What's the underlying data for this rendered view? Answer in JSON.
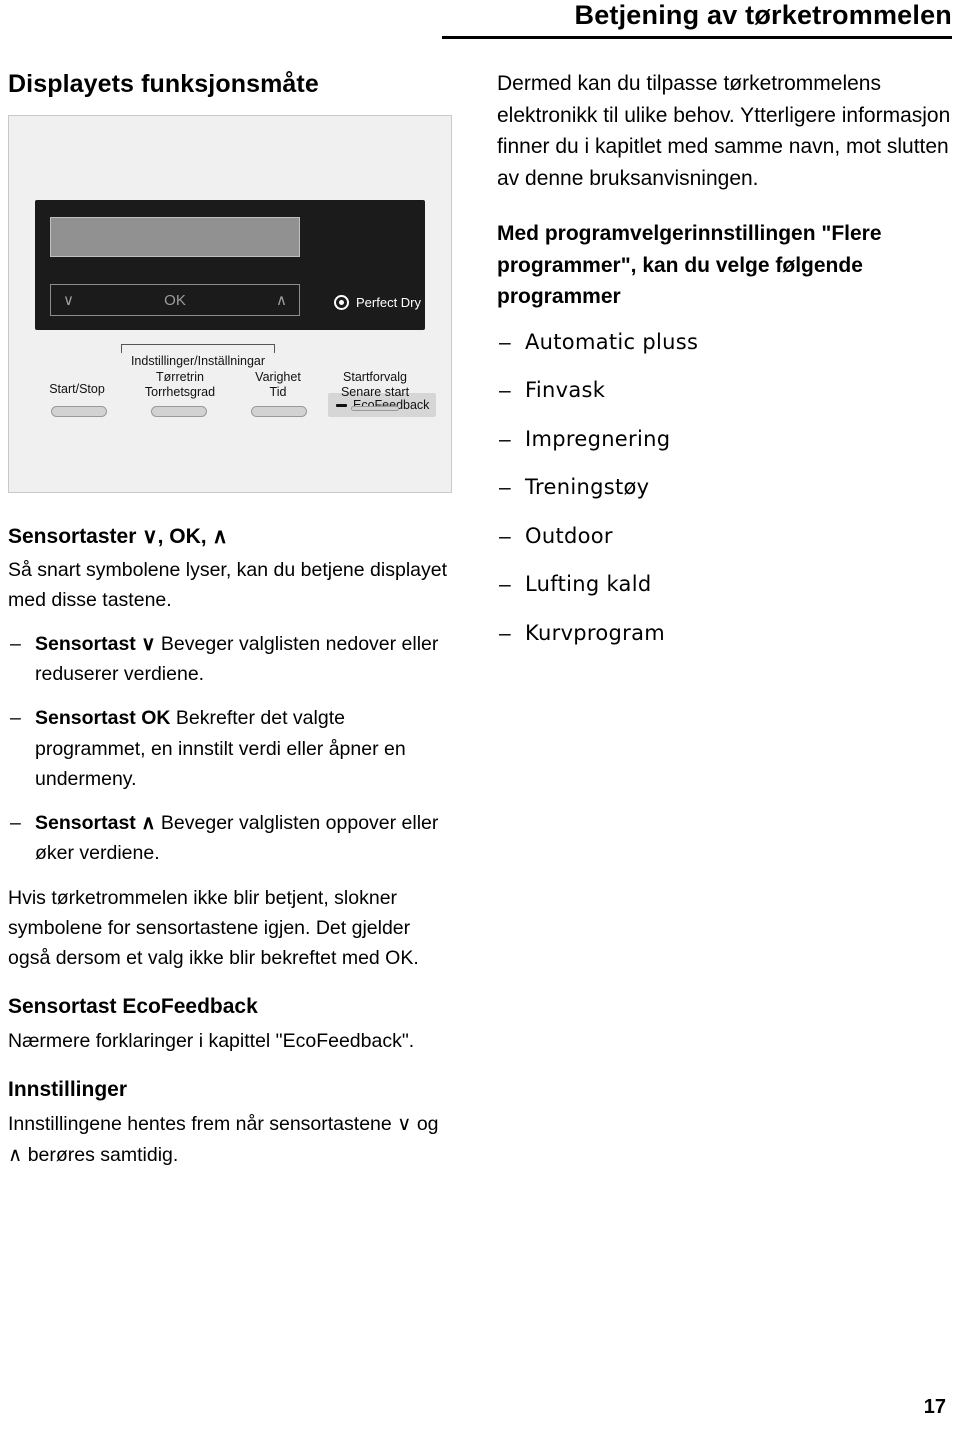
{
  "header": {
    "title": "Betjening av tørketrommelen"
  },
  "left": {
    "section_title": "Displayets funksjonsmåte",
    "panel": {
      "display_nav": {
        "down": "∨",
        "ok": "OK",
        "up": "∧"
      },
      "perfect_dry": "Perfect Dry",
      "ecofeedback": "EcoFeedback",
      "labels": {
        "start_stop": "Start/Stop",
        "settings": "Indstillinger/Inställningar",
        "dryness_1": "Tørretrin",
        "dryness_2": "Torrhetsgrad",
        "duration_1": "Varighet",
        "duration_2": "Tid",
        "delay_1": "Startforvalg",
        "delay_2": "Senare start"
      }
    },
    "sensor_heading": "Sensortaster ∨, OK, ∧",
    "sensor_intro": "Så snart symbolene lyser, kan du betjene displayet med disse tastene.",
    "bullets": [
      {
        "head": "Sensortast ∨",
        "body": "Beveger valglisten nedover eller reduserer verdiene."
      },
      {
        "head": "Sensortast OK",
        "body": "Bekrefter det valgte programmet, en innstilt verdi eller åpner en undermeny."
      },
      {
        "head": "Sensortast ∧",
        "body": "Beveger valglisten oppover eller øker verdiene."
      }
    ],
    "para_idle": "Hvis tørketrommelen ikke blir betjent, slokner symbolene for sensortastene igjen. Det gjelder også dersom et valg ikke blir bekreftet med OK.",
    "eco_heading": "Sensortast EcoFeedback",
    "eco_body": "Nærmere forklaringer i kapittel \"EcoFeedback\".",
    "settings_heading": "Innstillinger",
    "settings_body": "Innstillingene hentes frem når sensortastene ∨ og ∧ berøres samtidig."
  },
  "right": {
    "intro": "Dermed kan du tilpasse tørketrommelens elektronikk til ulike behov. Ytterligere informasjon finner du i kapitlet med samme navn, mot slutten av denne bruksanvisningen.",
    "programs_intro": "Med programvelgerinnstillingen \"Flere programmer\", kan du velge følgende programmer",
    "programs": [
      "Automatic pluss",
      "Finvask",
      "Impregnering",
      "Treningstøy",
      "Outdoor",
      "Lufting kald",
      "Kurvprogram"
    ]
  },
  "footer": {
    "page_number": "17"
  }
}
